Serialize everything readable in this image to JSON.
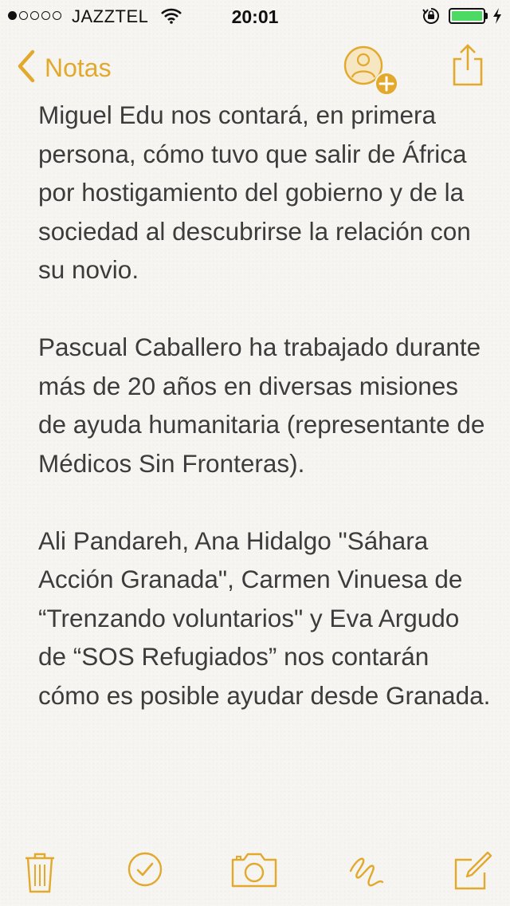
{
  "status_bar": {
    "carrier": "JAZZTEL",
    "time": "20:01",
    "signal_bars": 1,
    "signal_total": 5,
    "battery_color": "#4cd964"
  },
  "nav": {
    "back_label": "Notas",
    "accent_color": "#e2a92d",
    "icons": [
      "chevron-left-icon",
      "add-person-icon",
      "share-icon"
    ]
  },
  "note": {
    "paragraphs": [
      "Miguel Edu nos contará, en primera persona, cómo tuvo que salir de África por hostigamiento del gobierno y de la sociedad al descubrirse la relación con su novio.",
      "Pascual Caballero ha trabajado durante más de 20 años en diversas misiones de ayuda humanitaria (representante de Médicos Sin Fronteras).",
      "Ali Pandareh, Ana Hidalgo \"Sáhara Acción Granada\", Carmen Vinuesa de “Trenzando voluntarios\" y Eva Argudo de “SOS Refugiados” nos contarán cómo es posible ayudar desde Granada."
    ]
  },
  "toolbar": {
    "icons": [
      "trash-icon",
      "checklist-icon",
      "camera-icon",
      "sketch-icon",
      "compose-icon"
    ]
  }
}
